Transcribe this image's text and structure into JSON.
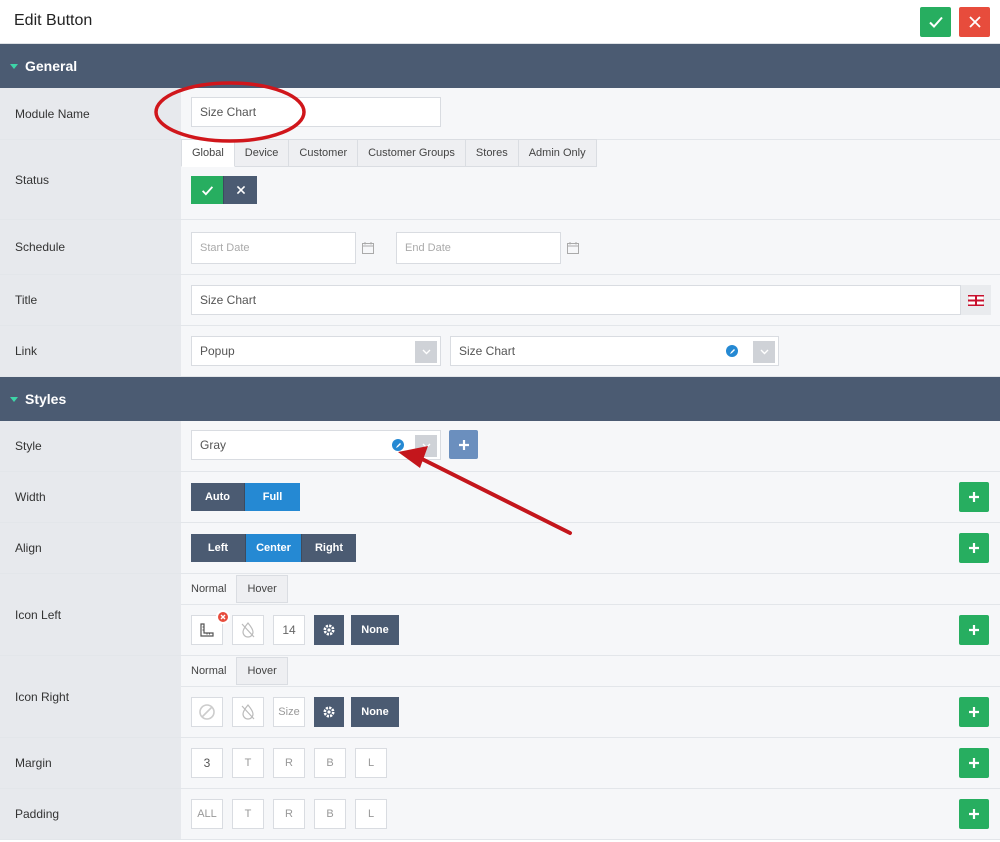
{
  "header": {
    "title": "Edit Button"
  },
  "sections": {
    "general": "General",
    "styles": "Styles"
  },
  "labels": {
    "module_name": "Module Name",
    "status": "Status",
    "schedule": "Schedule",
    "title": "Title",
    "link": "Link",
    "style": "Style",
    "width": "Width",
    "align": "Align",
    "icon_left": "Icon Left",
    "icon_right": "Icon Right",
    "margin": "Margin",
    "padding": "Padding"
  },
  "module_name": {
    "value": "Size Chart"
  },
  "status": {
    "tabs": [
      "Global",
      "Device",
      "Customer",
      "Customer Groups",
      "Stores",
      "Admin Only"
    ],
    "active_tab": "Global",
    "enabled": true
  },
  "schedule": {
    "start_placeholder": "Start Date",
    "end_placeholder": "End Date"
  },
  "title_field": {
    "value": "Size Chart"
  },
  "link": {
    "type": "Popup",
    "target": "Size Chart"
  },
  "style": {
    "value": "Gray"
  },
  "width": {
    "options": [
      "Auto",
      "Full"
    ],
    "selected": "Full"
  },
  "align": {
    "options": [
      "Left",
      "Center",
      "Right"
    ],
    "selected": "Center"
  },
  "icon_left": {
    "tabs": [
      "Normal",
      "Hover"
    ],
    "size": "14",
    "position": "None"
  },
  "icon_right": {
    "tabs": [
      "Normal",
      "Hover"
    ],
    "size_placeholder": "Size",
    "position": "None"
  },
  "margin": {
    "all": "3",
    "t": "T",
    "r": "R",
    "b": "B",
    "l": "L"
  },
  "padding": {
    "all": "ALL",
    "t": "T",
    "r": "R",
    "b": "B",
    "l": "L"
  },
  "colors": {
    "section_header": "#4b5b72",
    "accent_green": "#27ae60",
    "accent_red": "#e74c3c",
    "accent_blue": "#2589d3",
    "annotation_red": "#d0161b"
  }
}
